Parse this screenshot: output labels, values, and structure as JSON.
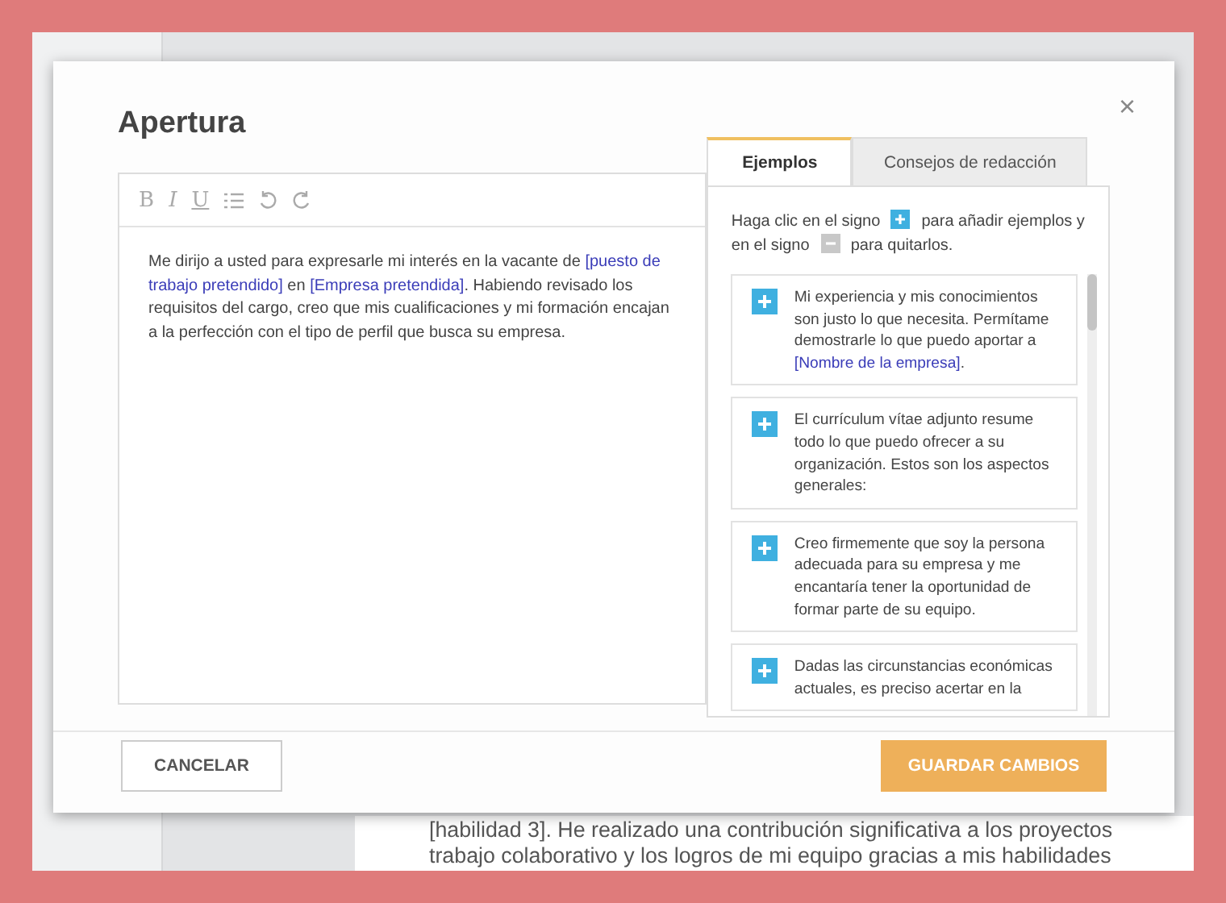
{
  "background": {
    "document_lines": [
      "[habilidad 3]. He realizado una contribución significativa a los proyectos",
      "trabajo colaborativo y los logros de mi equipo gracias a mis habilidades"
    ]
  },
  "modal": {
    "title": "Apertura",
    "close": "×",
    "toolbar": [
      {
        "kind": "bold",
        "label": "B"
      },
      {
        "kind": "italic",
        "label": "I"
      },
      {
        "kind": "underline",
        "label": "U"
      },
      {
        "kind": "list"
      },
      {
        "kind": "undo"
      },
      {
        "kind": "redo"
      }
    ],
    "editor_text": [
      {
        "kind": "text",
        "text": "Me dirijo a usted para expresarle mi interés en la vacante de "
      },
      {
        "kind": "field",
        "text": "[puesto de trabajo pretendido]"
      },
      {
        "kind": "text",
        "text": " en "
      },
      {
        "kind": "field",
        "text": "[Empresa pretendida]"
      },
      {
        "kind": "text",
        "text": ". Habiendo revisado los requisitos del cargo, creo que mis cualificaciones y mi formación encajan a la perfección con el tipo de perfil que busca su empresa."
      }
    ],
    "tabs": [
      {
        "label": "Ejemplos",
        "selected": true
      },
      {
        "label": "Consejos de redacción",
        "selected": false
      }
    ],
    "hint": [
      {
        "kind": "text",
        "text": "Haga clic en el signo "
      },
      {
        "kind": "plus"
      },
      {
        "kind": "text",
        "text": " para añadir ejemplos y en el signo "
      },
      {
        "kind": "minus"
      },
      {
        "kind": "text",
        "text": " para quitarlos."
      }
    ],
    "examples": [
      {
        "segments": [
          {
            "kind": "text",
            "text": "Mi experiencia y mis conocimientos son justo lo que necesita. Permítame demostrarle lo que puedo aportar a "
          },
          {
            "kind": "field",
            "text": "[Nombre de la empresa]"
          },
          {
            "kind": "text",
            "text": "."
          }
        ]
      },
      {
        "segments": [
          {
            "kind": "text",
            "text": "El currículum vítae adjunto resume todo lo que puedo ofrecer a su organización. Estos son los aspectos generales:"
          }
        ]
      },
      {
        "segments": [
          {
            "kind": "text",
            "text": "Creo firmemente que soy la persona adecuada para su empresa y me encantaría tener la oportunidad de formar parte de su equipo."
          }
        ]
      },
      {
        "segments": [
          {
            "kind": "text",
            "text": "Dadas las circunstancias económicas actuales, es preciso acertar en la"
          }
        ]
      }
    ],
    "buttons": {
      "cancel": "CANCELAR",
      "save": "GUARDAR CAMBIOS"
    }
  }
}
